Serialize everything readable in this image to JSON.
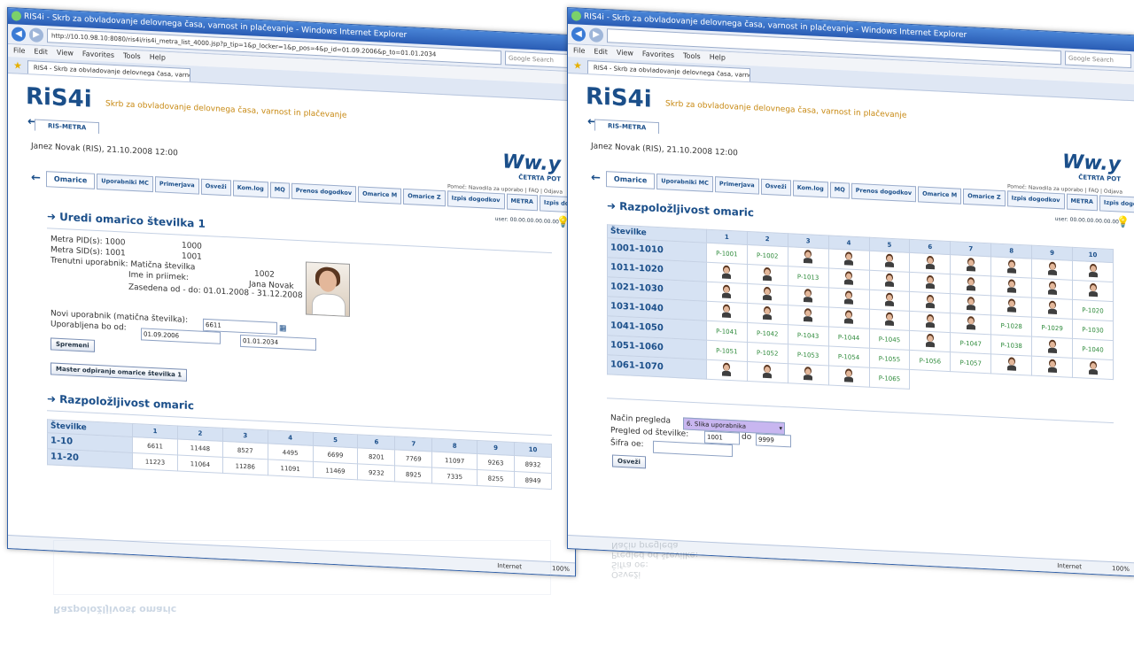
{
  "browser": {
    "window_title": "RIS4i - Skrb za obvladovanje delovnega časa, varnost in plačevanje - Windows Internet Explorer",
    "address_left": "http://10.10.98.10:8080/ris4i/ris4i_metra_list_4000.jsp?p_tip=1&p_locker=1&p_pos=4&p_id=01.09.2006&p_to=01.01.2034",
    "address_right": "",
    "search_placeholder": "Google Search",
    "menu": [
      "File",
      "Edit",
      "View",
      "Favorites",
      "Tools",
      "Help"
    ],
    "tab_label": "RIS4 - Skrb za obvladovanje delovnega časa, varnos...",
    "status_zone": "Internet",
    "status_zoom": "100%"
  },
  "app": {
    "logo": "RiS4i",
    "tagline": "Skrb za obvladovanje delovnega časa, varnost in plačevanje",
    "app_tab": "RIS-METRA",
    "user_line": "Janez Novak (RIS), 21.10.2008 12:00",
    "brand_logo": "Ww.y",
    "brand_name": "ČETRTA POT",
    "brand_links": "Pomoč: Navodila za uporabo | FAQ | Odjava",
    "user_id": "user: 00.00.00.00.00.00",
    "main_tabs": [
      "Omarice",
      "Uporabniki MC",
      "Primerjava",
      "Osveži",
      "Kom.log",
      "MQ",
      "Prenos dogodkov",
      "Omarice M",
      "Omarice Z",
      "Izpis dogodkov",
      "METRA",
      "Izpis dogodkov METRA"
    ]
  },
  "left": {
    "heading": "Uredi omarico številka 1",
    "pid_label": "Metra PID(s): 1000",
    "pid_value": "1000",
    "sid_label": "Metra SID(s): 1001",
    "sid_value": "1001",
    "current_user_label": "Trenutni uporabnik: Matična številka",
    "current_user_number": "1002",
    "name_label": "Ime in priimek:",
    "name_value": "Jana Novak",
    "occupied_label": "Zasedena od - do: 01.01.2008 - 31.12.2008",
    "new_user_label": "Novi uporabnik (matična številka):",
    "new_user_value": "6611",
    "used_from_label": "Uporabljena bo od:",
    "used_from_value": "01.09.2006",
    "used_to_value": "01.01.2034",
    "save_button": "Spremeni",
    "master_button": "Master odpiranje omarice številka 1",
    "avail_heading": "Razpoložljivost omaric",
    "table": {
      "header_first": "Številke",
      "columns": [
        "1",
        "2",
        "3",
        "4",
        "5",
        "6",
        "7",
        "8",
        "9",
        "10"
      ],
      "rows": [
        {
          "label": "1-10",
          "cells": [
            "6611",
            "11448",
            "8527",
            "4495",
            "6699",
            "8201",
            "7769",
            "11097",
            "9263",
            "8932"
          ]
        },
        {
          "label": "11-20",
          "cells": [
            "11223",
            "11064",
            "11286",
            "11091",
            "11469",
            "9232",
            "8925",
            "7335",
            "8255",
            "8949"
          ]
        }
      ]
    }
  },
  "right": {
    "heading": "Razpoložljivost omaric",
    "table": {
      "header_first": "Številke",
      "columns": [
        "1",
        "2",
        "3",
        "4",
        "5",
        "6",
        "7",
        "8",
        "9",
        "10"
      ],
      "rows": [
        {
          "label": "1001-1010",
          "cells": [
            "P-1001",
            "P-1002",
            "@",
            "@",
            "@",
            "@",
            "@",
            "@",
            "@",
            "@"
          ]
        },
        {
          "label": "1011-1020",
          "cells": [
            "@",
            "@",
            "P-1013",
            "@",
            "@",
            "@",
            "@",
            "@",
            "@",
            "@"
          ]
        },
        {
          "label": "1021-1030",
          "cells": [
            "@",
            "@",
            "@",
            "@",
            "@",
            "@",
            "@",
            "@",
            "@",
            "P-1020"
          ]
        },
        {
          "label": "1031-1040",
          "cells": [
            "@",
            "@",
            "@",
            "@",
            "@",
            "@",
            "@",
            "P-1028",
            "P-1029",
            "P-1030"
          ]
        },
        {
          "label": "1041-1050",
          "cells": [
            "P-1041",
            "P-1042",
            "P-1043",
            "P-1044",
            "P-1045",
            "@",
            "P-1047",
            "P-1038",
            "@",
            "P-1040"
          ]
        },
        {
          "label": "1051-1060",
          "cells": [
            "P-1051",
            "P-1052",
            "P-1053",
            "P-1054",
            "P-1055",
            "P-1056",
            "P-1057",
            "@",
            "@",
            "@"
          ]
        },
        {
          "label": "1061-1070",
          "cells": [
            "@",
            "@",
            "@",
            "@",
            "P-1065",
            "",
            "",
            "",
            "",
            ""
          ]
        }
      ]
    },
    "view_mode_label": "Način pregleda",
    "view_mode_value": "6. Slika uporabnika",
    "from_label": "Pregled od številke:",
    "from_value": "1001",
    "to_label": "do",
    "to_value": "9999",
    "code_label": "Šifra oe:",
    "code_value": "",
    "refresh_button": "Osveži"
  },
  "colors": {
    "accent": "#1b4f8a",
    "tagline": "#c88a14",
    "green_code": "#2d8a3a",
    "title_bar": "#2a5cb4"
  }
}
